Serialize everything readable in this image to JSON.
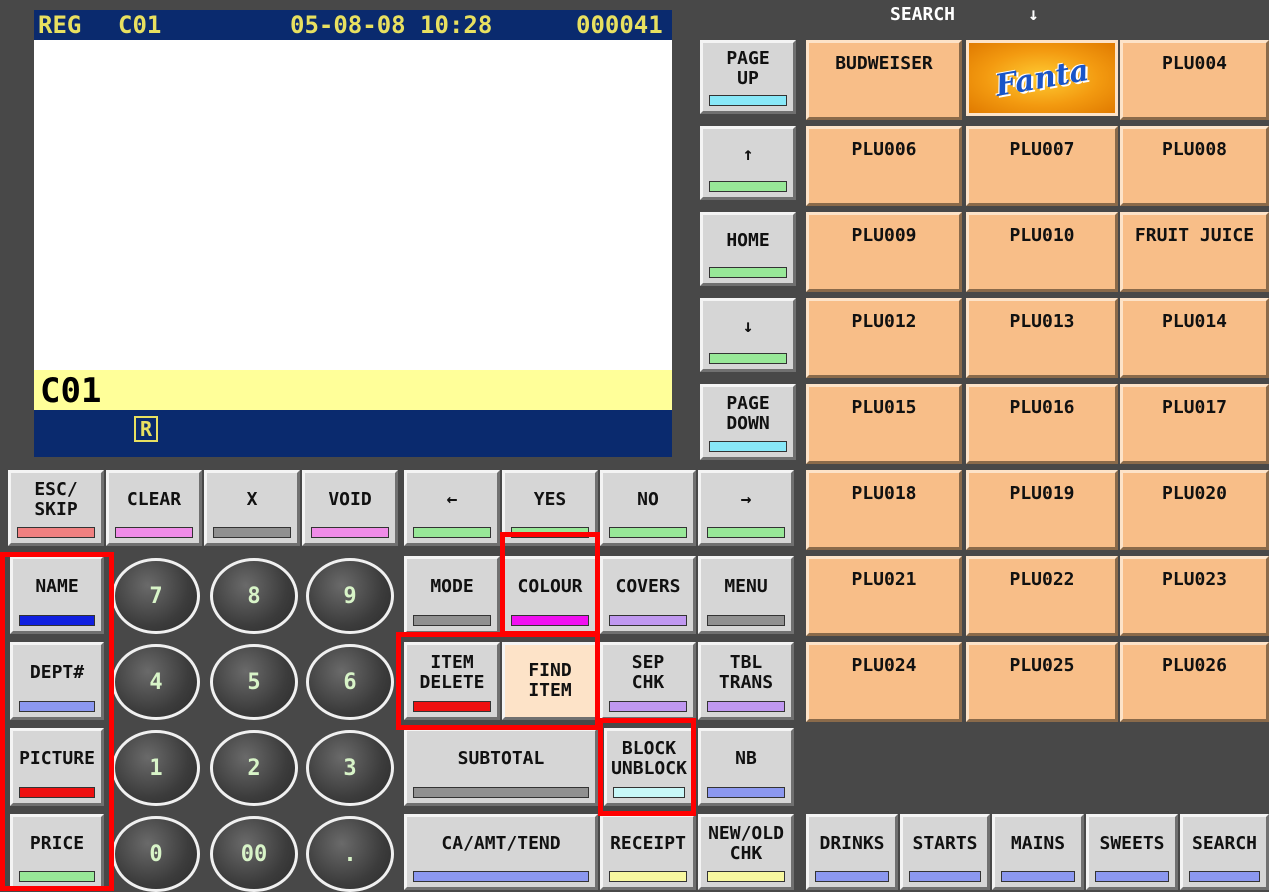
{
  "display": {
    "mode": "REG",
    "clerk": "C01",
    "date_time": "05-08-08 10:28",
    "receipt_no": "000041",
    "clerk_large": "C01",
    "status_mark": "R"
  },
  "nav": {
    "page_up": "PAGE\nUP",
    "up_arrow": "↑",
    "home": "HOME",
    "down_arrow": "↓",
    "page_down": "PAGE\nDOWN",
    "search_header": "SEARCH",
    "search_arrow": "↓"
  },
  "function_row": {
    "esc_skip": "ESC/\nSKIP",
    "clear": "CLEAR",
    "x": "X",
    "void": "VOID",
    "left_arrow": "←",
    "yes": "YES",
    "no": "NO",
    "right_arrow": "→"
  },
  "left_column": {
    "name": "NAME",
    "dept": "DEPT#",
    "picture": "PICTURE",
    "price": "PRICE"
  },
  "keypad": {
    "k7": "7",
    "k8": "8",
    "k9": "9",
    "k4": "4",
    "k5": "5",
    "k6": "6",
    "k1": "1",
    "k2": "2",
    "k3": "3",
    "k0": "0",
    "k00": "00",
    "kdot": "."
  },
  "functions": {
    "mode": "MODE",
    "colour": "COLOUR",
    "covers": "COVERS",
    "menu": "MENU",
    "item_delete": "ITEM\nDELETE",
    "find_item": "FIND\nITEM",
    "sep_chk": "SEP\nCHK",
    "tbl_trans": "TBL\nTRANS",
    "subtotal": "SUBTOTAL",
    "block_unblock": "BLOCK\nUNBLOCK",
    "nb": "NB",
    "ca_amt_tend": "CA/AMT/TEND",
    "receipt": "RECEIPT",
    "new_old_chk": "NEW/OLD\nCHK"
  },
  "plu_grid": [
    [
      "BUDWEISER",
      "Fanta",
      "PLU004"
    ],
    [
      "PLU006",
      "PLU007",
      "PLU008"
    ],
    [
      "PLU009",
      "PLU010",
      "FRUIT JUICE"
    ],
    [
      "PLU012",
      "PLU013",
      "PLU014"
    ],
    [
      "PLU015",
      "PLU016",
      "PLU017"
    ],
    [
      "PLU018",
      "PLU019",
      "PLU020"
    ],
    [
      "PLU021",
      "PLU022",
      "PLU023"
    ],
    [
      "PLU024",
      "PLU025",
      "PLU026"
    ]
  ],
  "categories": {
    "drinks": "DRINKS",
    "starts": "STARTS",
    "mains": "MAINS",
    "sweets": "SWEETS",
    "search": "SEARCH"
  },
  "colors": {
    "plu_button": "#f8be88",
    "display_header": "#0a2a6e",
    "highlight": "#ff0000"
  }
}
